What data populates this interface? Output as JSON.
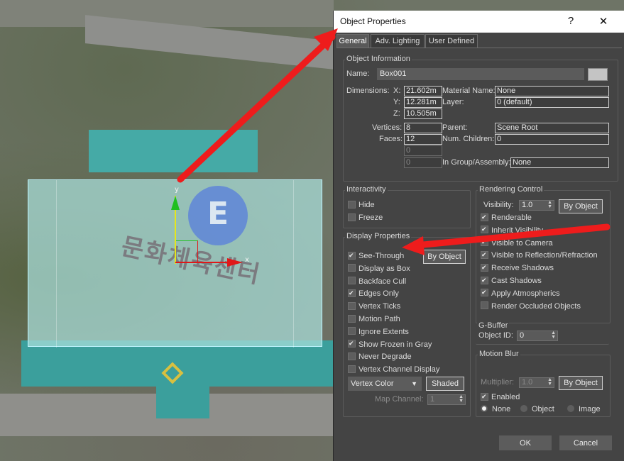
{
  "dialog": {
    "title": "Object Properties",
    "help_label": "?",
    "close_label": "✕",
    "tabs": [
      {
        "label": "General",
        "active": true
      },
      {
        "label": "Adv. Lighting",
        "active": false
      },
      {
        "label": "User Defined",
        "active": false
      }
    ],
    "ok_label": "OK",
    "cancel_label": "Cancel"
  },
  "object_info": {
    "title": "Object Information",
    "name_label": "Name:",
    "name_value": "Box001",
    "dimensions_label": "Dimensions:",
    "x_label": "X:",
    "x_value": "21.602m",
    "y_label": "Y:",
    "y_value": "12.281m",
    "z_label": "Z:",
    "z_value": "10.505m",
    "vertices_label": "Vertices:",
    "vertices_value": "8",
    "faces_label": "Faces:",
    "faces_value": "12",
    "extra1_value": "0",
    "extra2_value": "0",
    "material_label": "Material Name:",
    "material_value": "None",
    "layer_label": "Layer:",
    "layer_value": "0 (default)",
    "parent_label": "Parent:",
    "parent_value": "Scene Root",
    "children_label": "Num. Children:",
    "children_value": "0",
    "group_label": "In Group/Assembly:",
    "group_value": "None"
  },
  "interactivity": {
    "title": "Interactivity",
    "items": [
      {
        "label": "Hide",
        "checked": false
      },
      {
        "label": "Freeze",
        "checked": false
      }
    ]
  },
  "display_properties": {
    "title": "Display Properties",
    "by_object_label": "By Object",
    "items": [
      {
        "label": "See-Through",
        "checked": true
      },
      {
        "label": "Display as Box",
        "checked": false
      },
      {
        "label": "Backface Cull",
        "checked": false
      },
      {
        "label": "Edges Only",
        "checked": true
      },
      {
        "label": "Vertex Ticks",
        "checked": false
      },
      {
        "label": "Motion Path",
        "checked": false
      },
      {
        "label": "Ignore Extents",
        "checked": false
      },
      {
        "label": "Show Frozen in Gray",
        "checked": true
      },
      {
        "label": "Never Degrade",
        "checked": false
      },
      {
        "label": "Vertex Channel Display",
        "checked": false
      }
    ],
    "vertex_color_label": "Vertex Color",
    "shaded_label": "Shaded",
    "map_channel_label": "Map Channel:",
    "map_channel_value": "1"
  },
  "rendering_control": {
    "title": "Rendering Control",
    "visibility_label": "Visibility:",
    "visibility_value": "1.0",
    "by_object_label": "By Object",
    "items": [
      {
        "label": "Renderable",
        "checked": true
      },
      {
        "label": "Inherit Visibility",
        "checked": true
      },
      {
        "label": "Visible to Camera",
        "checked": true
      },
      {
        "label": "Visible to Reflection/Refraction",
        "checked": true
      },
      {
        "label": "Receive Shadows",
        "checked": true
      },
      {
        "label": "Cast Shadows",
        "checked": true
      },
      {
        "label": "Apply Atmospherics",
        "checked": true
      },
      {
        "label": "Render Occluded Objects",
        "checked": false
      }
    ]
  },
  "gbuffer": {
    "title": "G-Buffer",
    "object_id_label": "Object ID:",
    "object_id_value": "0"
  },
  "motion_blur": {
    "title": "Motion Blur",
    "multiplier_label": "Multiplier:",
    "multiplier_value": "1.0",
    "by_object_label": "By Object",
    "enabled_label": "Enabled",
    "enabled_checked": true,
    "radios": [
      {
        "label": "None",
        "selected": true
      },
      {
        "label": "Object",
        "selected": false
      },
      {
        "label": "Image",
        "selected": false
      }
    ]
  },
  "viewport": {
    "helipad_letter": "E",
    "roof_text": "문화체육센터",
    "axis_x": "x",
    "axis_y": "y"
  },
  "colors": {
    "annotation_arrow": "#ee1c1c",
    "selection_box": "#bff5ff",
    "dialog_bg": "#444444"
  }
}
